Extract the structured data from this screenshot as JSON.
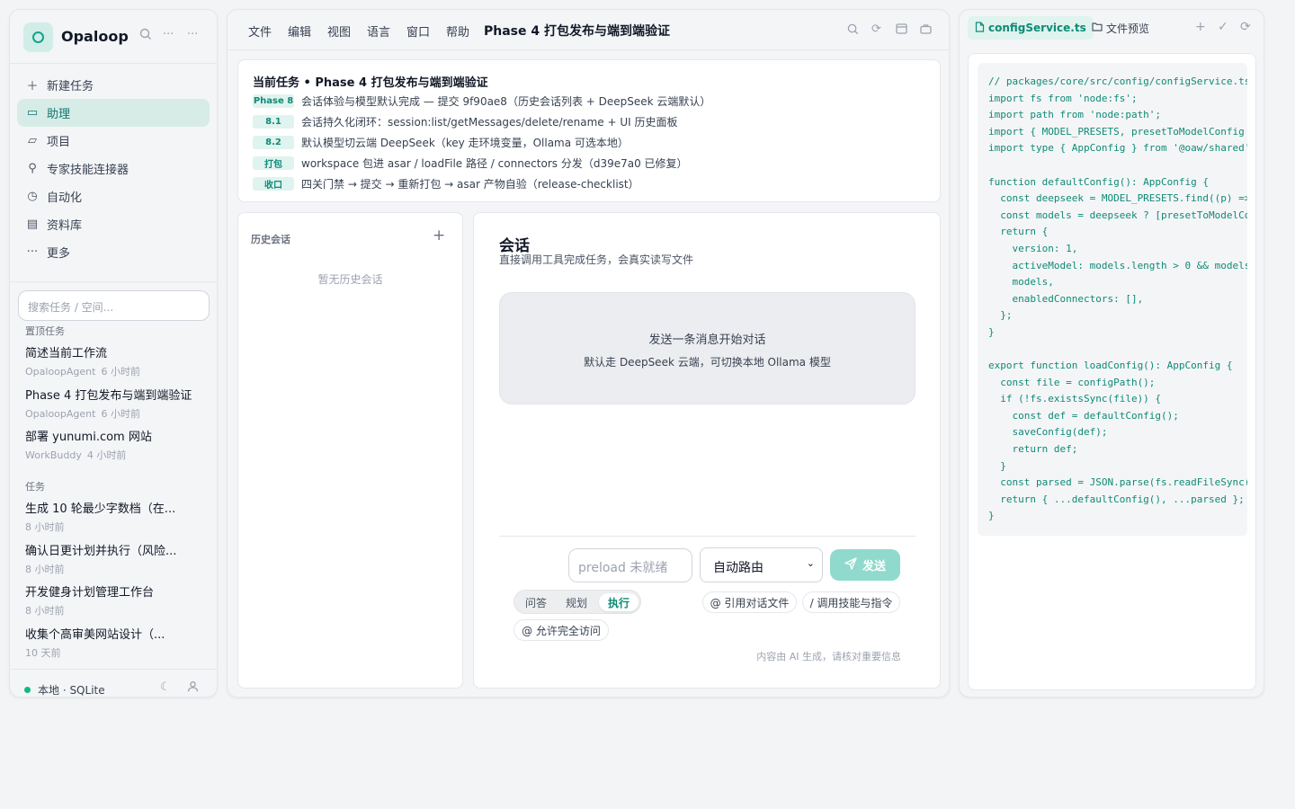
{
  "app": {
    "name": "Opaloop"
  },
  "sidebar": {
    "header_icons": [
      "search-icon",
      "more-icon",
      "menu-icon"
    ],
    "nav": [
      {
        "icon": "＋",
        "label": "新建任务",
        "active": false
      },
      {
        "icon": "▭",
        "label": "助理",
        "active": true
      },
      {
        "icon": "▱",
        "label": "项目",
        "active": false
      },
      {
        "icon": "⚲",
        "label": "专家技能连接器",
        "active": false
      },
      {
        "icon": "◷",
        "label": "自动化",
        "active": false
      },
      {
        "icon": "▤",
        "label": "资料库",
        "active": false
      },
      {
        "icon": "···",
        "label": "更多",
        "active": false
      }
    ],
    "search_placeholder": "搜索任务 / 空间...",
    "pinned_label": "置顶任务",
    "pinned": [
      {
        "title": "简述当前工作流",
        "source": "OpaloopAgent",
        "time": "6 小时前"
      },
      {
        "title": "Phase 4 打包发布与端到端验证",
        "source": "OpaloopAgent",
        "time": "6 小时前"
      },
      {
        "title": "部署 yunumi.com 网站",
        "source": "WorkBuddy",
        "time": "4 小时前"
      }
    ],
    "tasks_label": "任务",
    "tasks": [
      {
        "title": "生成 10 轮最少字数档（在...",
        "time": "8 小时前"
      },
      {
        "title": "确认日更计划并执行（风险...",
        "time": "8 小时前"
      },
      {
        "title": "开发健身计划管理工作台",
        "time": "8 小时前"
      },
      {
        "title": "收集个高审美网站设计（...",
        "time": "10 天前"
      }
    ],
    "footer": {
      "status": "本地 · SQLite"
    }
  },
  "menubar": {
    "items": [
      "文件",
      "编辑",
      "视图",
      "语言",
      "窗口",
      "帮助"
    ],
    "title": "Phase 4 打包发布与端到端验证"
  },
  "task_card": {
    "title": "当前任务 • Phase 4 打包发布与端到端验证",
    "rows": [
      {
        "badge": "Phase 8",
        "text": "会话体验与模型默认完成 — 提交 9f90ae8（历史会话列表 + DeepSeek 云端默认）"
      },
      {
        "badge": "8.1",
        "text": "会话持久化闭环：session:list/getMessages/delete/rename + UI 历史面板"
      },
      {
        "badge": "8.2",
        "text": "默认模型切云端 DeepSeek（key 走环境变量，Ollama 可选本地）"
      },
      {
        "badge": "打包",
        "text": "workspace 包进 asar / loadFile 路径 / connectors 分发（d39e7a0 已修复）"
      },
      {
        "badge": "收口",
        "text": "四关门禁 → 提交 → 重新打包 → asar 产物自验（release-checklist）"
      }
    ]
  },
  "history": {
    "title": "历史会话",
    "empty": "暂无历史会话"
  },
  "chat": {
    "title": "会话",
    "subtitle": "直接调用工具完成任务，会真实读写文件",
    "empty_line1": "发送一条消息开始对话",
    "empty_line2": "默认走 DeepSeek 云端，可切换本地 Ollama 模型",
    "input_placeholder": "preload 未就绪",
    "route_select": "自动路由",
    "send_label": "发送",
    "modes": [
      "问答",
      "规划",
      "执行"
    ],
    "active_mode": "执行",
    "chip_files": "@ 引用对话文件",
    "chip_skills": "/ 调用技能与指令",
    "chip_access": "@ 允许完全访问",
    "disclaimer": "内容由 AI 生成，请核对重要信息"
  },
  "right_panel": {
    "tabs": [
      "configService.ts",
      "文件预览"
    ],
    "code": "// packages/core/src/config/configService.ts\nimport fs from 'node:fs';\nimport path from 'node:path';\nimport { MODEL_PRESETS, presetToModelConfig\nimport type { AppConfig } from '@oaw/shared'\n\nfunction defaultConfig(): AppConfig {\n  const deepseek = MODEL_PRESETS.find((p) =>\n  const models = deepseek ? [presetToModelCo\n  return {\n    version: 1,\n    activeModel: models.length > 0 && models\n    models,\n    enabledConnectors: [],\n  };\n}\n\nexport function loadConfig(): AppConfig {\n  const file = configPath();\n  if (!fs.existsSync(file)) {\n    const def = defaultConfig();\n    saveConfig(def);\n    return def;\n  }\n  const parsed = JSON.parse(fs.readFileSync(\n  return { ...defaultConfig(), ...parsed };\n}"
  },
  "colors": {
    "accent": "#0f8a76",
    "accent_bg": "#dff3ef",
    "send_bg": "#8fdacc",
    "status_green": "#10b981"
  }
}
